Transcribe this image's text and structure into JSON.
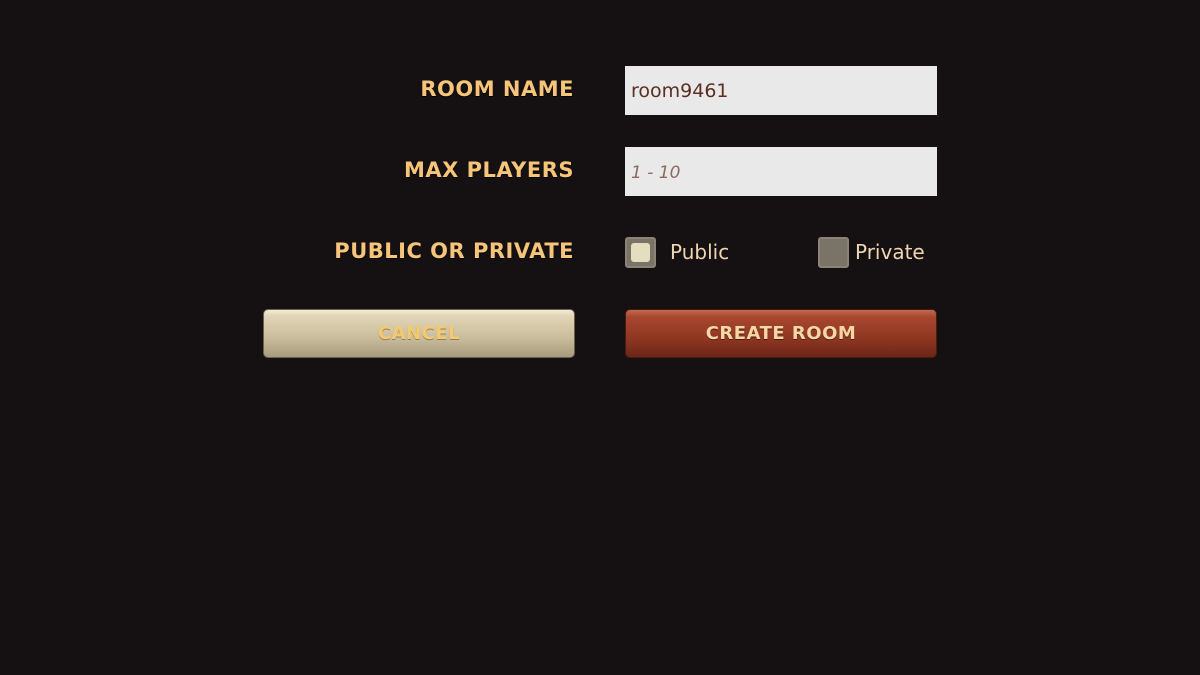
{
  "form": {
    "room_name": {
      "label": "ROOM NAME",
      "value": "room9461"
    },
    "max_players": {
      "label": "MAX PLAYERS",
      "placeholder": "1 - 10",
      "value": ""
    },
    "visibility": {
      "label": "PUBLIC OR PRIVATE",
      "public_label": "Public",
      "private_label": "Private",
      "selected": "Public"
    }
  },
  "buttons": {
    "cancel_label": "CANCEL",
    "create_label": "CREATE ROOM"
  },
  "colors": {
    "background": "#151112",
    "label_text": "#f6c57a",
    "create_button": "#9a3d27",
    "cancel_button": "#cfc3a3"
  }
}
